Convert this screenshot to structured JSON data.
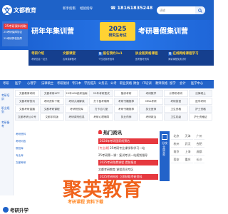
{
  "header": {
    "logo_mark": "文",
    "logo_text": "文都教育",
    "nav": [
      "新手指南",
      "经验指导"
    ],
    "phone": "18161835248",
    "phone_icon": "phone-icon",
    "search_placeholder": "请输",
    "search_icon": "search-icon"
  },
  "banner": {
    "tag": "25考研資料领取",
    "sublines": [
      "25考研保障协议",
      "25考研择校指导"
    ],
    "title_left": "研年年集训营",
    "year": "2025",
    "year_sub": "研究生考试",
    "title_right": "考研暑假集训营"
  },
  "quick": [
    {
      "tag": "",
      "title": "考研介绍",
      "sub": "考研信息一站式"
    },
    {
      "tag": "",
      "title": "文都课堂",
      "sub": "名师讲解备考"
    },
    {
      "tag": "抢",
      "title": "报名预约1v1",
      "sub": "个性化报考指导"
    },
    {
      "tag": "",
      "title": "执业医资格课程",
      "sub": "医考备考资料"
    },
    {
      "tag": "抢",
      "title": "在线网络课程学习",
      "sub": "海量课程免费试听"
    }
  ],
  "subnav": [
    "考研",
    "医学",
    "心理学",
    "法律硕士",
    "考研复试",
    "专升本",
    "学历提升",
    "公务员",
    "公考",
    "职业资格",
    "财会",
    "IT培训",
    "教师资格",
    "留学",
    "会计",
    "医学中心"
  ],
  "left_col": [
    "考研培训",
    "职业规划",
    "考研备考"
  ],
  "grid": [
    [
      "文都教育考研",
      "文都考研APP",
      "25年408统考指南",
      "25年考研复试",
      "管综考研",
      "考研数学",
      "计算机考研",
      "法律硕士"
    ],
    [
      "文都考研快讯",
      "考研资料下载",
      "考研大纲解读",
      "打卡备考辅导",
      "考研书籍推荐",
      "MBA考研",
      "考研英语",
      "医学考研"
    ],
    [
      "文都考研直播",
      "文都考研课程",
      "考研院校库",
      "打卡自习室",
      "考研书籍推荐",
      "执业医师",
      "卫生资格",
      "护士资格"
    ],
    [
      "文都考研公众号",
      "文都手机版",
      "考研调剂信息",
      "考研心理辅导",
      "执业药师",
      "考研政治",
      "卫生初级",
      "护士资格证"
    ]
  ],
  "left_text": [
    "考研资料",
    "考研问答",
    "院校库",
    "专业库",
    "文都考研"
  ],
  "hot": {
    "title": "热门资讯",
    "rows": [
      {
        "style": "hl",
        "tag": "",
        "text": "2024年考研国家线预估"
      },
      {
        "style": "plain",
        "tag": "[专业课]",
        "text": "25考研专业课学科学习一站"
      },
      {
        "style": "plain",
        "tag": "",
        "text": "25考研第一课：复试考试一站规划指导"
      },
      {
        "style": "hl",
        "tag": "",
        "text": "2025考研免费课程 提前报名"
      },
      {
        "style": "plain",
        "tag": "",
        "text": "文都考研教育 课程资讯专区"
      },
      {
        "style": "hl",
        "tag": "",
        "text": "2025考研网校 立即获取考研资料"
      }
    ]
  },
  "cities": {
    "head": "分校",
    "vertical": "全国分校",
    "list": [
      "北京",
      "天津",
      "广州",
      "杭州",
      "武汉",
      "合肥",
      "南京",
      "上海",
      "成都",
      "西安",
      "重庆",
      "长沙"
    ]
  },
  "footer": {
    "title": "考研升学"
  },
  "watermark": {
    "main": "聚英教育",
    "sub": "考研课程 资料下载"
  }
}
